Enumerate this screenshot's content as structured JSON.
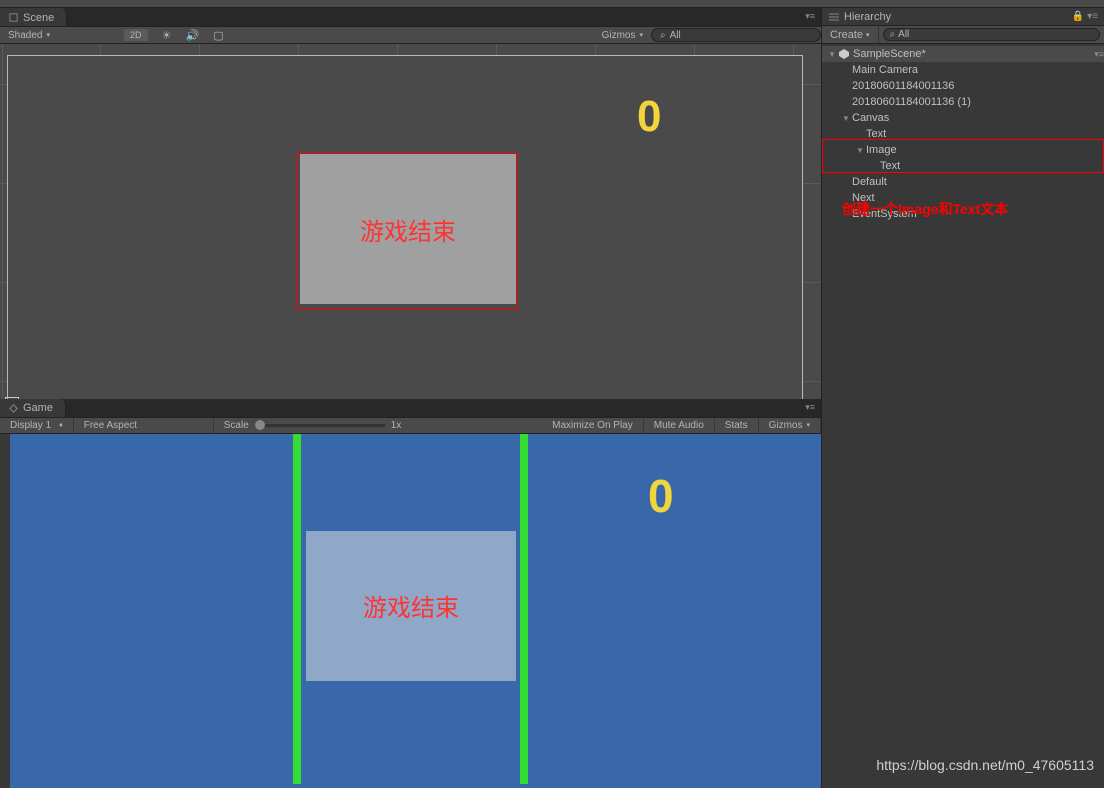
{
  "scene": {
    "tab_label": "Scene",
    "shading_mode": "Shaded",
    "btn_2d": "2D",
    "gizmos": "Gizmos",
    "search_placeholder": "All",
    "score_text": "0",
    "game_over_text": "游戏结束"
  },
  "game": {
    "tab_label": "Game",
    "display": "Display 1",
    "aspect": "Free Aspect",
    "scale_label": "Scale",
    "scale_value": "1x",
    "max_on_play": "Maximize On Play",
    "mute": "Mute Audio",
    "stats": "Stats",
    "gizmos": "Gizmos",
    "score_text": "0",
    "game_over_text": "游戏结束"
  },
  "hierarchy": {
    "title": "Hierarchy",
    "create": "Create",
    "search_placeholder": "All",
    "scene_name": "SampleScene*",
    "items": [
      {
        "name": "Main Camera",
        "indent": 1
      },
      {
        "name": "20180601184001136",
        "indent": 1
      },
      {
        "name": "20180601184001136 (1)",
        "indent": 1
      },
      {
        "name": "Canvas",
        "indent": 1,
        "arrow": "down"
      },
      {
        "name": "Text",
        "indent": 2
      },
      {
        "name": "Image",
        "indent": 2,
        "arrow": "down"
      },
      {
        "name": "Text",
        "indent": 3
      },
      {
        "name": "Default",
        "indent": 1
      },
      {
        "name": "Next",
        "indent": 1
      },
      {
        "name": "EventSystem",
        "indent": 1
      }
    ]
  },
  "annotation": "创建一个Image和Text文本",
  "watermark": "https://blog.csdn.net/m0_47605113"
}
